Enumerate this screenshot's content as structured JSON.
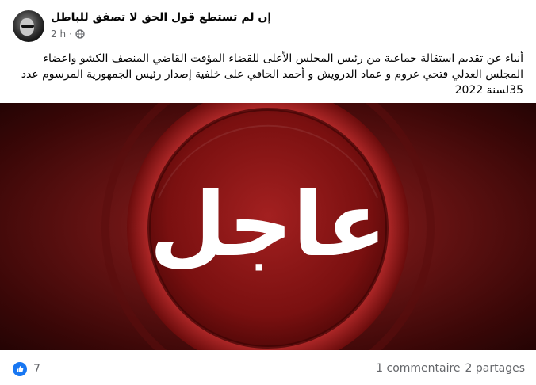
{
  "post": {
    "author": "إن لم تستطع قول الحق لا تصفق للباطل",
    "time": "2 h",
    "text": "أنباء عن تقديم استقالة جماعية من رئيس المجلس الأعلى للقضاء المؤقت القاضي المنصف الكشو واعضاء المجلس العدلي فتحي عروم و عماد الدرويش و أحمد الحافي على خلفية إصدار رئيس الجمهورية المرسوم عدد 35لسنة 2022",
    "image_text": "عاجل",
    "image_colors": {
      "dark": "#3a0707",
      "mid": "#6a1414",
      "ring": "#b02a2a"
    }
  },
  "footer": {
    "like_count": "7",
    "comments": "1 commentaire",
    "shares": "2 partages"
  },
  "icons": {
    "reaction": "like-icon",
    "privacy": "globe-icon"
  },
  "colors": {
    "accent": "#1877f2",
    "secondary_text": "#65676b"
  }
}
